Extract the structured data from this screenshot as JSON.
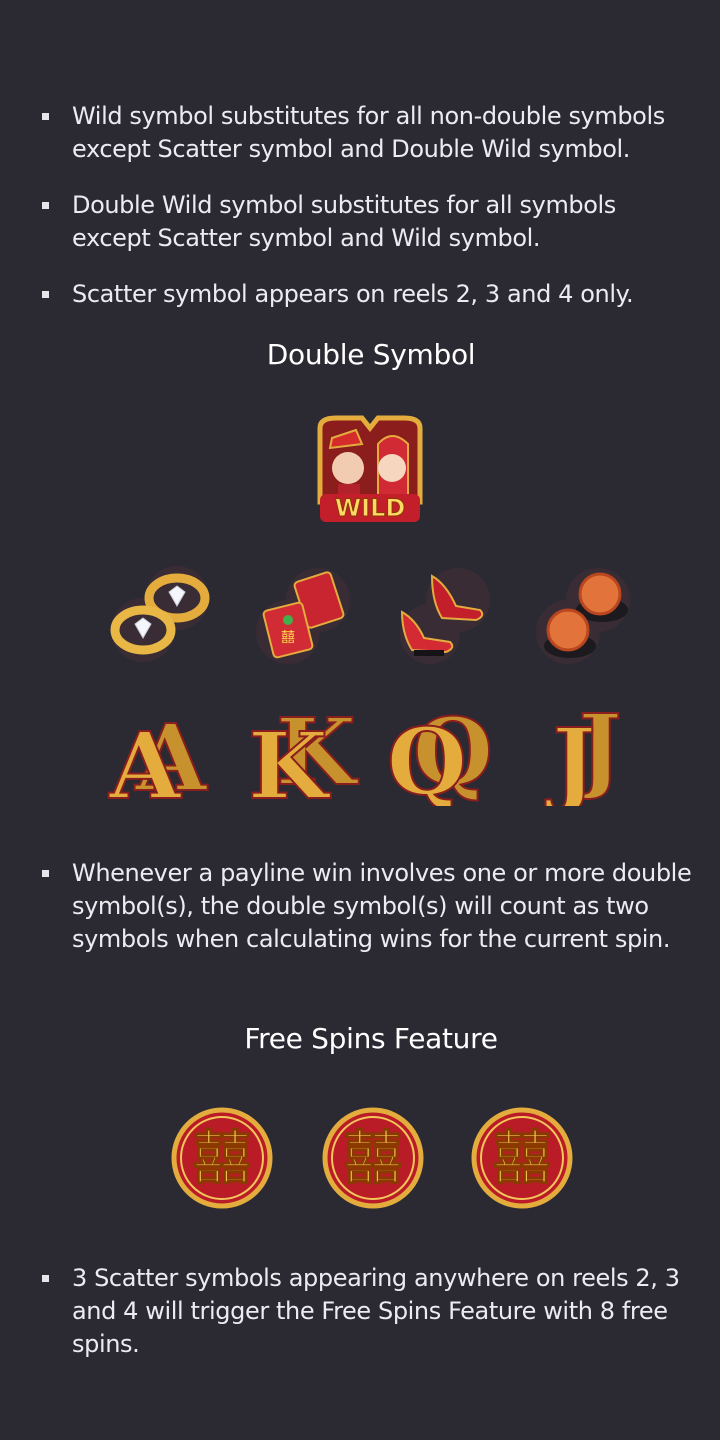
{
  "rules_top": [
    "Wild symbol substitutes for all non-double symbols except Scatter symbol and Double Wild symbol.",
    "Double Wild symbol substitutes for all symbols except Scatter symbol and Wild symbol.",
    "Scatter symbol appears on reels 2, 3 and 4 only."
  ],
  "double_symbol": {
    "heading": "Double Symbol",
    "wild_label": "WILD",
    "items_row1": [
      "gold-rings-icon",
      "red-envelopes-icon",
      "red-shoes-icon",
      "mooncakes-icon"
    ],
    "letters": [
      "A",
      "K",
      "Q",
      "J"
    ],
    "rule": "Whenever a payline win involves one or more double symbol(s), the double symbol(s) will count as two symbols when calculating wins for the current spin."
  },
  "free_spins": {
    "heading": "Free Spins Feature",
    "scatter_glyph": "囍",
    "scatter_count": 3,
    "rule": "3 Scatter symbols appearing anywhere on reels 2, 3 and 4 will trigger the Free Spins Feature with 8 free spins."
  },
  "colors": {
    "background": "#2b2a33",
    "gold": "#e3ac3c",
    "red": "#c21f2b"
  }
}
